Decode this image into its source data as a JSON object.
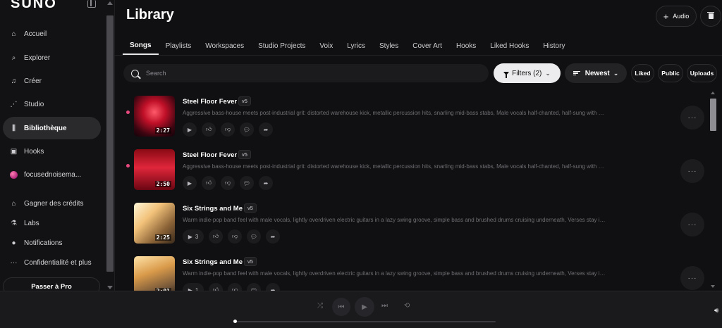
{
  "sidebar": {
    "logo": "SUNO",
    "items": [
      {
        "label": "Accueil",
        "icon": "home-icon",
        "glyph": "⌂"
      },
      {
        "label": "Explorer",
        "icon": "search-icon",
        "glyph": "⌕"
      },
      {
        "label": "Créer",
        "icon": "music-note-icon",
        "glyph": "♫"
      },
      {
        "label": "Studio",
        "icon": "studio-icon",
        "glyph": "⋰"
      },
      {
        "label": "Bibliothèque",
        "icon": "library-icon",
        "glyph": "⫼",
        "active": true
      },
      {
        "label": "Hooks",
        "icon": "hooks-icon",
        "glyph": "▣"
      },
      {
        "label": "focusednoisema...",
        "icon": "avatar",
        "glyph": ""
      },
      {
        "label": "Gagner des crédits",
        "icon": "earn-icon",
        "glyph": "⌂"
      },
      {
        "label": "Labs",
        "icon": "flask-icon",
        "glyph": "⚗"
      },
      {
        "label": "Notifications",
        "icon": "bell-icon",
        "glyph": "●"
      },
      {
        "label": "Confidentialité et plus",
        "icon": "more-icon",
        "glyph": "···"
      }
    ],
    "pro_button": "Passer à Pro"
  },
  "header": {
    "title": "Library",
    "audio_button": "Audio"
  },
  "tabs": [
    "Songs",
    "Playlists",
    "Workspaces",
    "Studio Projects",
    "Voix",
    "Lyrics",
    "Styles",
    "Cover Art",
    "Hooks",
    "Liked Hooks",
    "History"
  ],
  "active_tab": "Songs",
  "search": {
    "placeholder": "Search",
    "value": ""
  },
  "filters": {
    "filters_label": "Filters (2)",
    "sort_label": "Newest",
    "pills": [
      "Liked",
      "Public",
      "Uploads"
    ]
  },
  "songs": [
    {
      "title": "Steel Floor Fever",
      "version": "v5",
      "duration": "2:27",
      "new": true,
      "play_count": "",
      "description": "Aggressive bass-house meets post-industrial grit: distorted warehouse kick, metallic percussion hits, snarling mid-bass stabs, Male vocals half-chanted, half-sung with gang...",
      "art": "red"
    },
    {
      "title": "Steel Floor Fever",
      "version": "v5",
      "duration": "2:50",
      "new": true,
      "play_count": "",
      "description": "Aggressive bass-house meets post-industrial grit: distorted warehouse kick, metallic percussion hits, snarling mid-bass stabs, Male vocals half-chanted, half-sung with gang...",
      "art": "red2"
    },
    {
      "title": "Six Strings and Me",
      "version": "v5",
      "duration": "2:25",
      "new": false,
      "play_count": "3",
      "description": "Warm indie-pop band feel with male vocals, lightly overdriven electric guitars in a lazy swing groove, simple bass and brushed drums cruising underneath, Verses stay intimat...",
      "art": "warm"
    },
    {
      "title": "Six Strings and Me",
      "version": "v5",
      "duration": "2:01",
      "new": false,
      "play_count": "1",
      "description": "Warm indie-pop band feel with male vocals, lightly overdriven electric guitars in a lazy swing groove, simple bass and brushed drums cruising underneath, Verses stay intimat...",
      "art": "warm2"
    }
  ],
  "player": {
    "progress": 0.0
  }
}
